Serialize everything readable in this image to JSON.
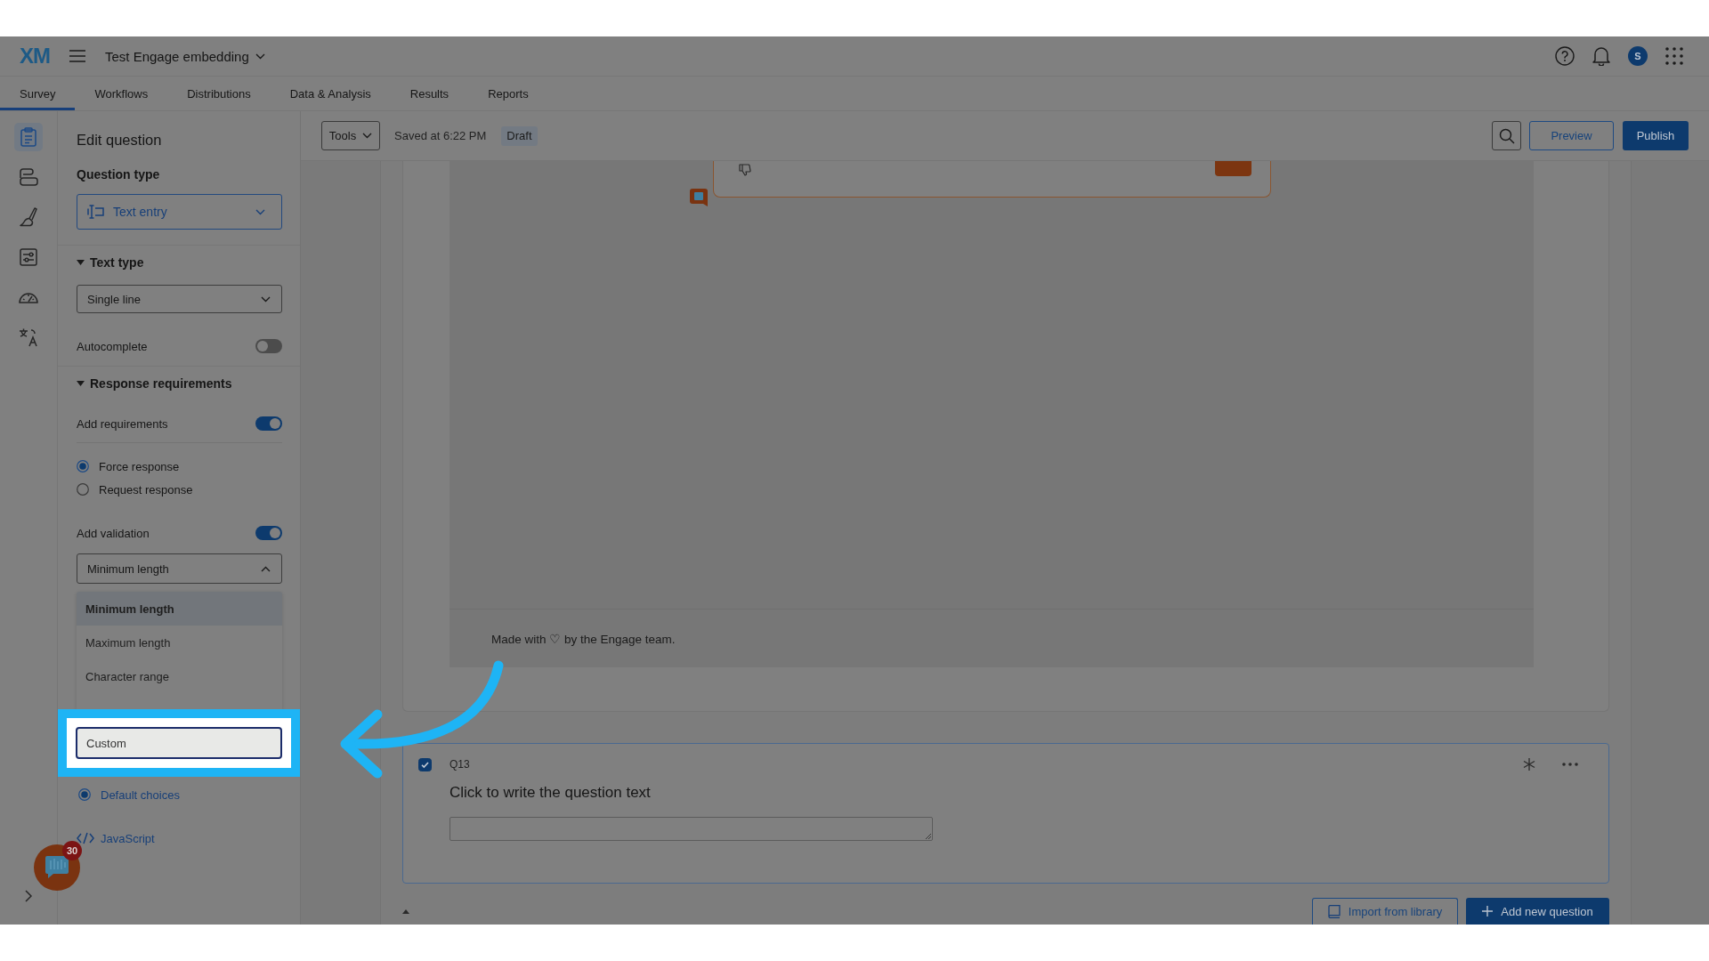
{
  "header": {
    "logo": "XM",
    "project_title": "Test Engage embedding",
    "avatar_initial": "S"
  },
  "tabs": [
    {
      "label": "Survey",
      "selected": true
    },
    {
      "label": "Workflows",
      "selected": false
    },
    {
      "label": "Distributions",
      "selected": false
    },
    {
      "label": "Data & Analysis",
      "selected": false
    },
    {
      "label": "Results",
      "selected": false
    },
    {
      "label": "Reports",
      "selected": false
    }
  ],
  "rail": [
    {
      "selected": true
    },
    {
      "selected": false
    },
    {
      "selected": false
    },
    {
      "selected": false
    },
    {
      "selected": false
    },
    {
      "selected": false
    }
  ],
  "toolbar": {
    "tools_label": "Tools",
    "saved_text": "Saved at 6:22 PM",
    "status_badge": "Draft",
    "preview_label": "Preview",
    "publish_label": "Publish"
  },
  "edit_panel": {
    "title": "Edit question",
    "question_type_heading": "Question type",
    "question_type_value": "Text entry",
    "text_type": {
      "heading": "Text type",
      "expanded": true,
      "select_value": "Single line",
      "autocomplete": {
        "label": "Autocomplete",
        "on": false
      }
    },
    "response_requirements": {
      "heading": "Response requirements",
      "expanded": true,
      "add_requirements": {
        "label": "Add requirements",
        "on": true
      },
      "options": [
        {
          "label": "Force response",
          "selected": true
        },
        {
          "label": "Request response",
          "selected": false
        }
      ],
      "add_validation": {
        "label": "Add validation",
        "on": true
      },
      "validation_select": {
        "value": "Minimum length",
        "expanded": true
      },
      "validation_menu": [
        {
          "label": "Minimum length",
          "selected": true,
          "highlighted": false
        },
        {
          "label": "Maximum length",
          "selected": false,
          "highlighted": false
        },
        {
          "label": "Character range",
          "selected": false,
          "highlighted": false
        },
        {
          "label": "Custom",
          "selected": false,
          "highlighted": true
        }
      ]
    },
    "choices_option": {
      "label": "Default choices",
      "selected": true
    },
    "javascript_link": "JavaScript"
  },
  "engage_launcher": {
    "badge_count": "30"
  },
  "canvas": {
    "embed_preview": {
      "footer": "Made with ♡ by the Engage team."
    },
    "question": {
      "number": "Q13",
      "checked": true,
      "selected": true,
      "text": "Click to write the question text"
    },
    "buttons": {
      "import_label": "Import from library",
      "add_label": "Add new question"
    }
  }
}
